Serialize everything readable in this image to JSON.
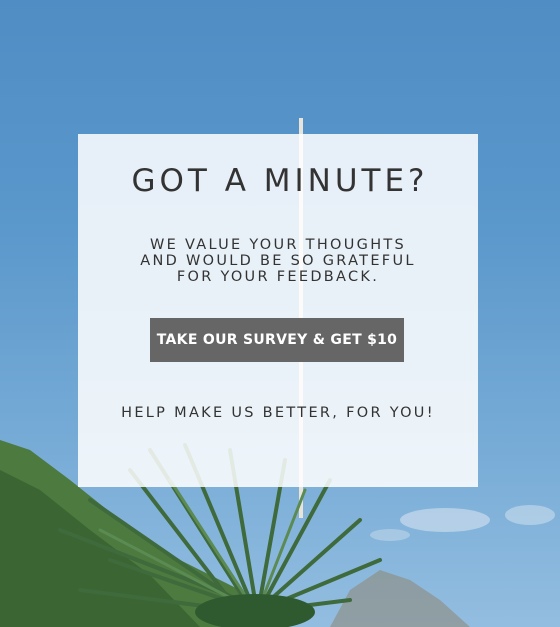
{
  "background": {
    "description_colors": {
      "sky_top": "#4f8dc4",
      "sky_bottom": "#93bde0",
      "foliage": "#3f6e3a"
    }
  },
  "modal": {
    "headline": "GOT A MINUTE?",
    "subtext_lines": [
      "WE VALUE YOUR THOUGHTS",
      "AND WOULD BE SO GRATEFUL",
      "FOR YOUR FEEDBACK."
    ],
    "cta_label": "TAKE OUR SURVEY & GET $10",
    "footer": "HELP MAKE US BETTER, FOR YOU!",
    "colors": {
      "text": "#333333",
      "button_bg": "#666666",
      "button_text": "#ffffff",
      "card_bg": "rgba(255,255,255,0.86)"
    }
  }
}
